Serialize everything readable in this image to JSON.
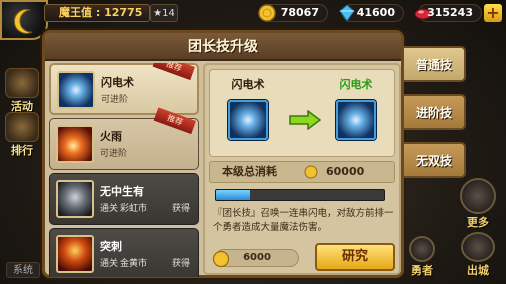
{
  "topbar": {
    "player_title_label": "魔王值",
    "player_title_value": "12775",
    "level": "14",
    "gold": "78067",
    "crystal": "41600",
    "gem": "315243",
    "plus_label": "+"
  },
  "left_menu": [
    {
      "label": "活动"
    },
    {
      "label": "排行"
    }
  ],
  "system_label": "系统",
  "right_menu": {
    "more_label": "更多",
    "hero_label": "勇者",
    "exit_label": "出城"
  },
  "dialog": {
    "title": "团长技升级",
    "skills": [
      {
        "name": "闪电术",
        "status": "可进阶",
        "ribbon": "推荐",
        "icon": "lightning-sword-icon"
      },
      {
        "name": "火雨",
        "status": "可进阶",
        "ribbon": "推荐",
        "icon": "fire-rain-icon"
      },
      {
        "name": "无中生有",
        "source": "通关",
        "location": "彩虹市",
        "status": "获得",
        "icon": "armor-icon"
      },
      {
        "name": "突刺",
        "source": "通关",
        "location": "金黄市",
        "status": "获得",
        "icon": "crown-spike-icon"
      }
    ],
    "detail": {
      "current_name": "闪电术",
      "next_name": "闪电术",
      "cost_label": "本级总消耗",
      "cost_value": "60000",
      "progress": 0.2,
      "description": "『团长技』召唤一连串闪电，对敌方前排一个勇者造成大量魔法伤害。",
      "study_cost": "6000",
      "study_button": "研究"
    },
    "tabs": [
      {
        "label": "普通技",
        "active": true
      },
      {
        "label": "进阶技",
        "active": false
      },
      {
        "label": "无双技",
        "active": false
      }
    ]
  },
  "colors": {
    "gold": "#f2c230",
    "accent_blue": "#40a0d8",
    "next_name_green": "#2a9a18"
  }
}
